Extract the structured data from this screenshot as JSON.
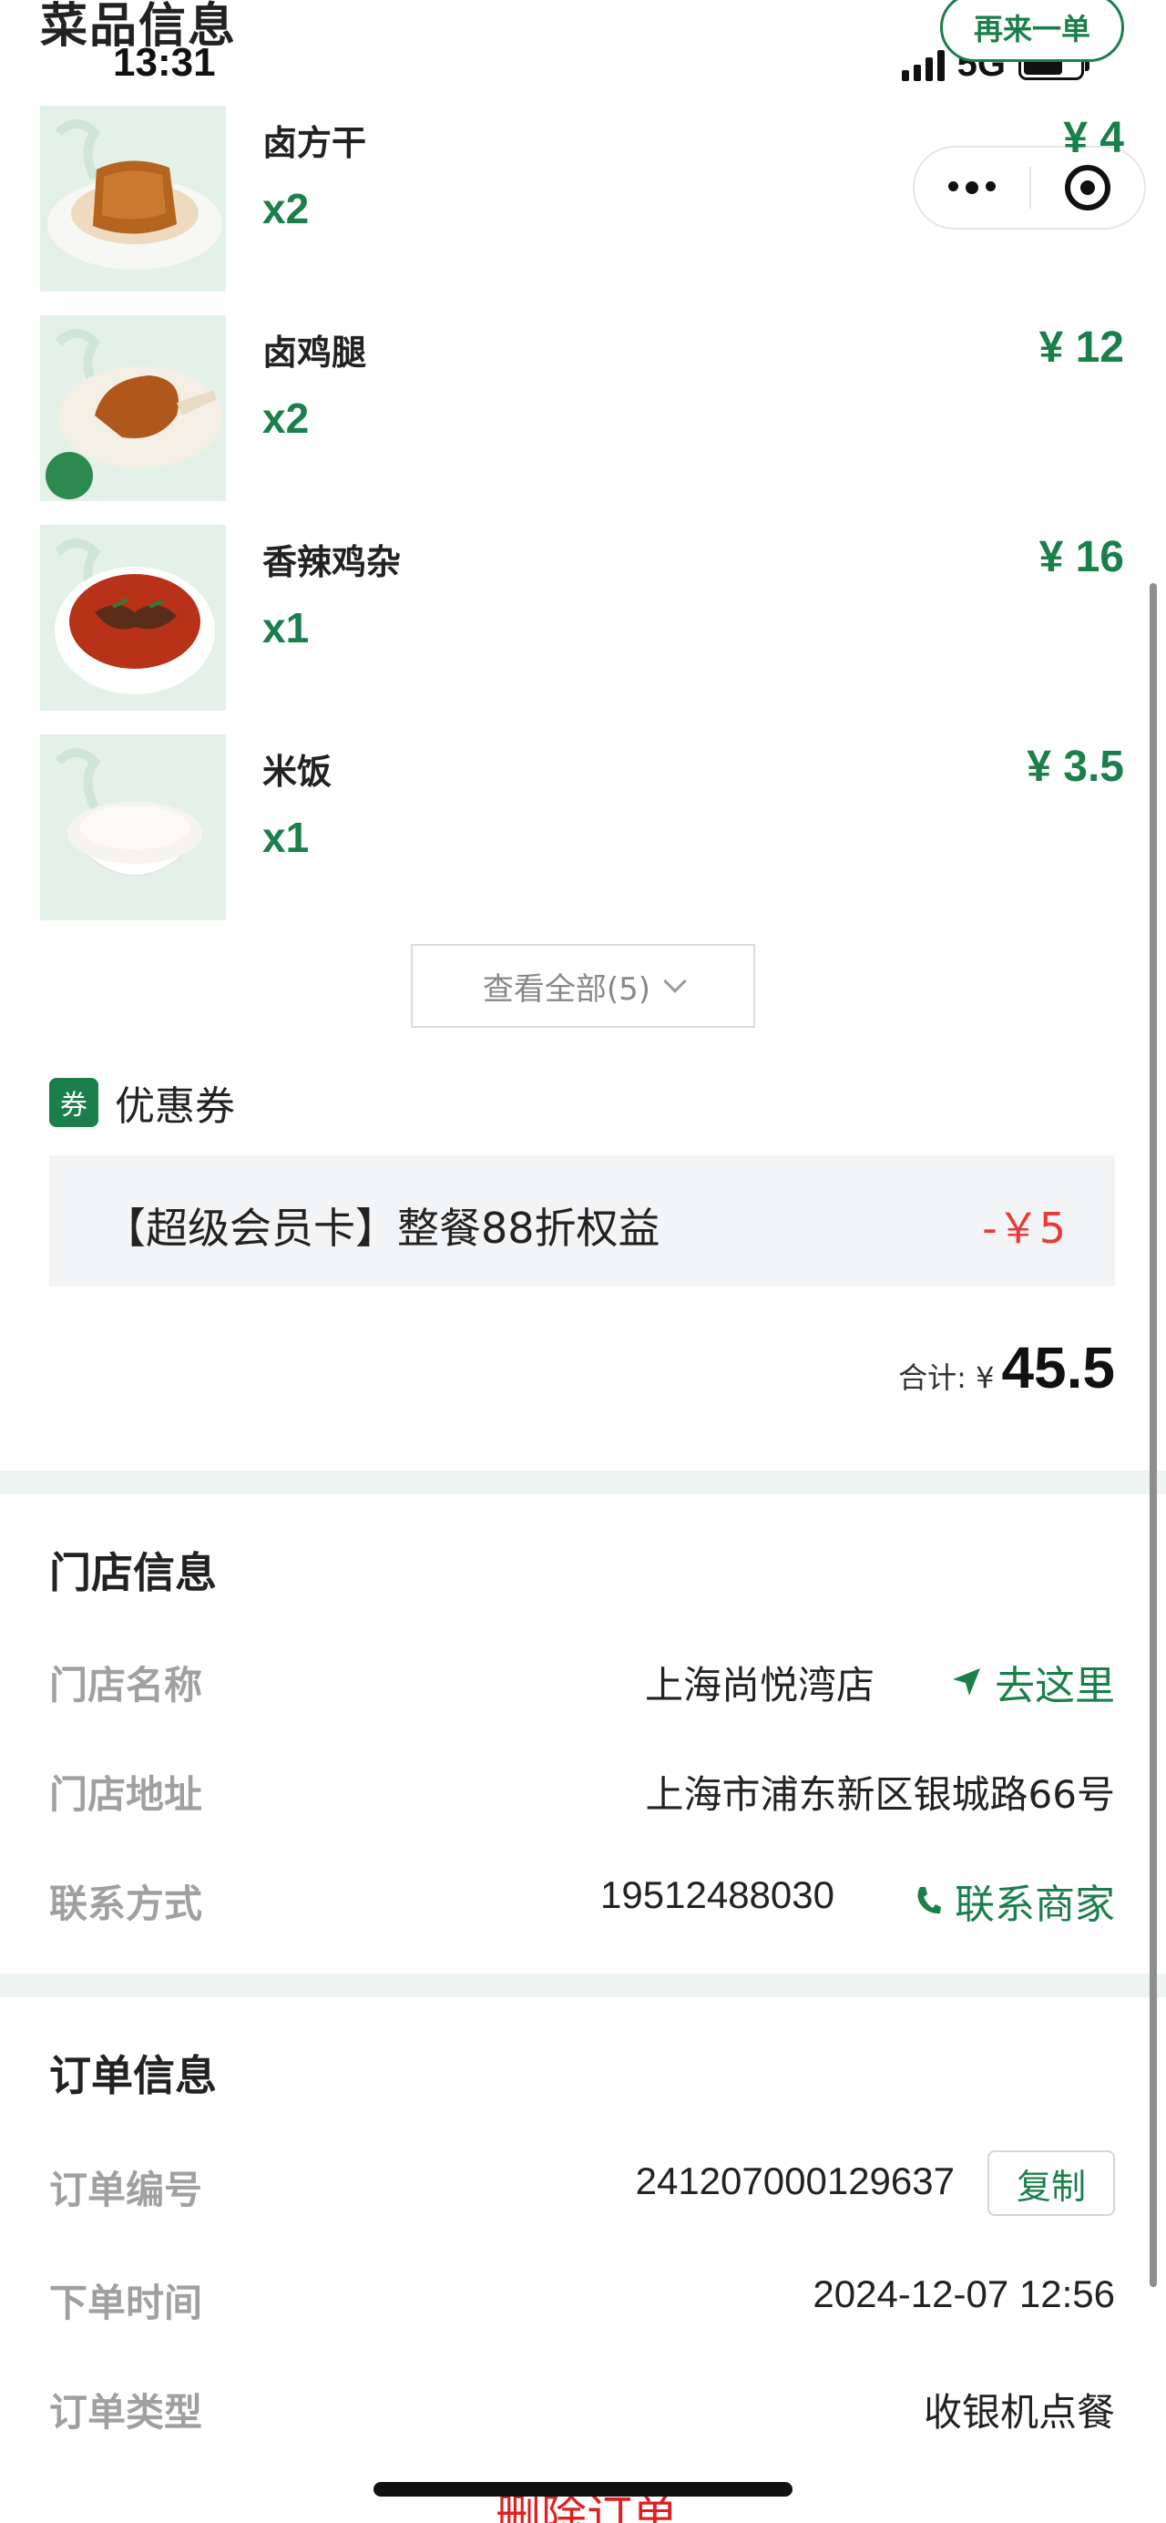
{
  "header": {
    "page_title": "菜品信息",
    "reorder_label": "再来一单"
  },
  "status_bar": {
    "time": "13:31",
    "network": "5G"
  },
  "dishes": [
    {
      "name": "卤方干",
      "quantity": "x2",
      "price": "¥ 4"
    },
    {
      "name": "卤鸡腿",
      "quantity": "x2",
      "price": "¥ 12"
    },
    {
      "name": "香辣鸡杂",
      "quantity": "x1",
      "price": "¥ 16"
    },
    {
      "name": "米饭",
      "quantity": "x1",
      "price": "¥ 3.5"
    }
  ],
  "view_all_label": "查看全部(5)",
  "coupon": {
    "badge": "券",
    "title": "优惠券",
    "name": "【超级会员卡】整餐88折权益",
    "amount": "-￥5"
  },
  "total": {
    "label": "合计: ¥",
    "value": "45.5"
  },
  "store_info": {
    "title": "门店信息",
    "name_label": "门店名称",
    "name_value": "上海尚悦湾店",
    "navigate_label": "去这里",
    "address_label": "门店地址",
    "address_value": "上海市浦东新区银城路66号",
    "contact_label": "联系方式",
    "contact_value": "19512488030",
    "contact_action": "联系商家"
  },
  "order_info": {
    "title": "订单信息",
    "number_label": "订单编号",
    "number_value": "241207000129637",
    "copy_label": "复制",
    "time_label": "下单时间",
    "time_value": "2024-12-07 12:56",
    "type_label": "订单类型",
    "type_value": "收银机点餐"
  },
  "delete_order_label": "删除订单",
  "colors": {
    "brand_green": "#1a7f4b",
    "discount_red": "#e83a3a",
    "section_divider": "#edf4f2"
  }
}
